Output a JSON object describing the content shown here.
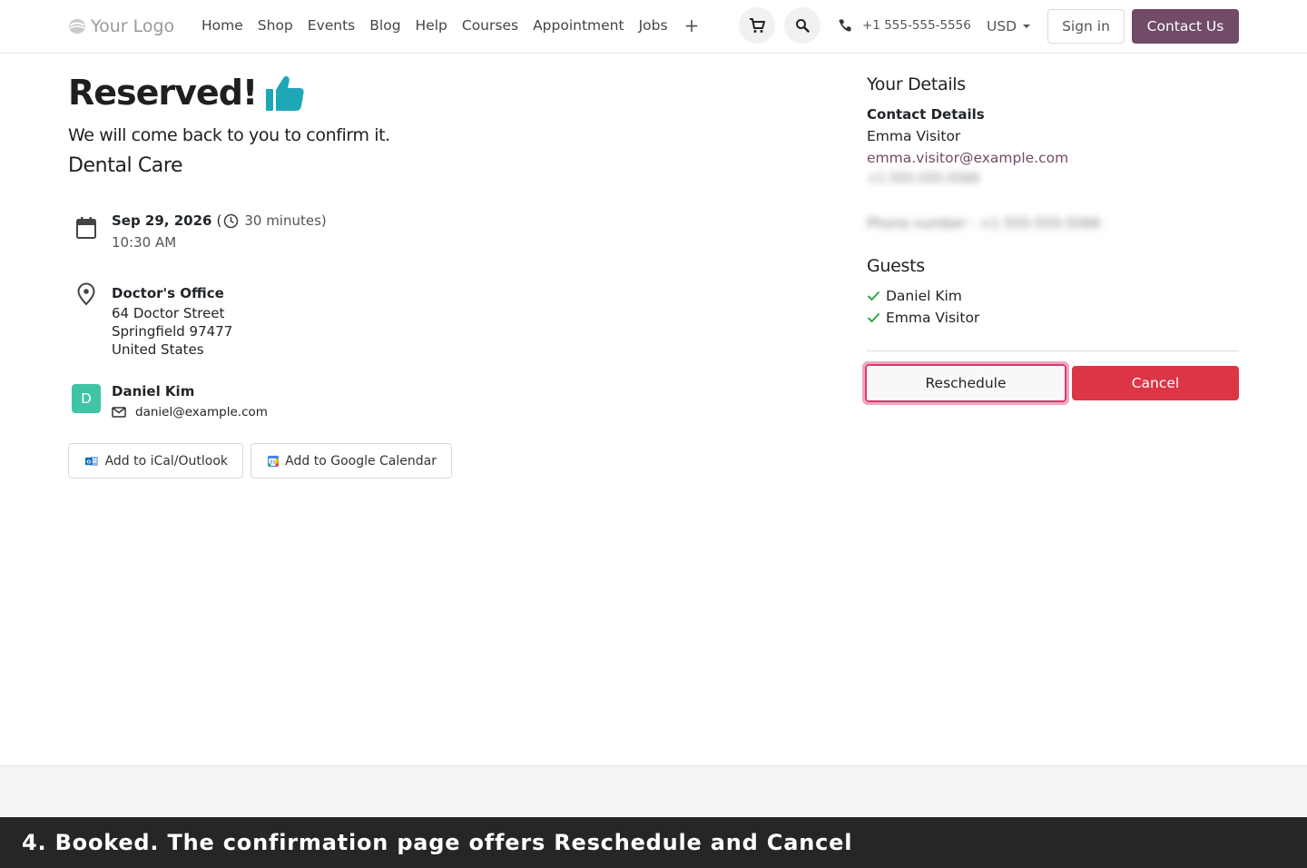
{
  "header": {
    "logo_text": "Your Logo",
    "nav_items": [
      "Home",
      "Shop",
      "Events",
      "Blog",
      "Help",
      "Courses",
      "Appointment",
      "Jobs"
    ],
    "plus_label": "+",
    "phone": "+1 555-555-5556",
    "currency": "USD",
    "signin_label": "Sign in",
    "contact_label": "Contact Us",
    "brand_color": "#714b67"
  },
  "confirmation": {
    "title": "Reserved!",
    "subtitle": "We will come back to you to confirm it.",
    "service": "Dental Care",
    "date": "Sep 29, 2026",
    "paren_open": "(",
    "duration": "30 minutes)",
    "time": "10:30 AM",
    "location": {
      "name": "Doctor's Office",
      "street": "64 Doctor Street",
      "city": "Springfield 97477",
      "country": "United States"
    },
    "staff": {
      "initial": "D",
      "name": "Daniel Kim",
      "email": "daniel@example.com"
    },
    "ical_label": "Add to iCal/Outlook",
    "gcal_label": "Add to Google Calendar"
  },
  "details": {
    "heading": "Your Details",
    "contact_label": "Contact Details",
    "name": "Emma Visitor",
    "email": "emma.visitor@example.com",
    "phone_blurred": "+1 555-555-5566",
    "phone_field_blurred": "Phone number : +1 555-555-5566",
    "guests_heading": "Guests",
    "guests": [
      "Daniel Kim",
      "Emma Visitor"
    ],
    "reschedule_label": "Reschedule",
    "cancel_label": "Cancel"
  },
  "caption": "4. Booked. The confirmation page offers Reschedule and Cancel"
}
